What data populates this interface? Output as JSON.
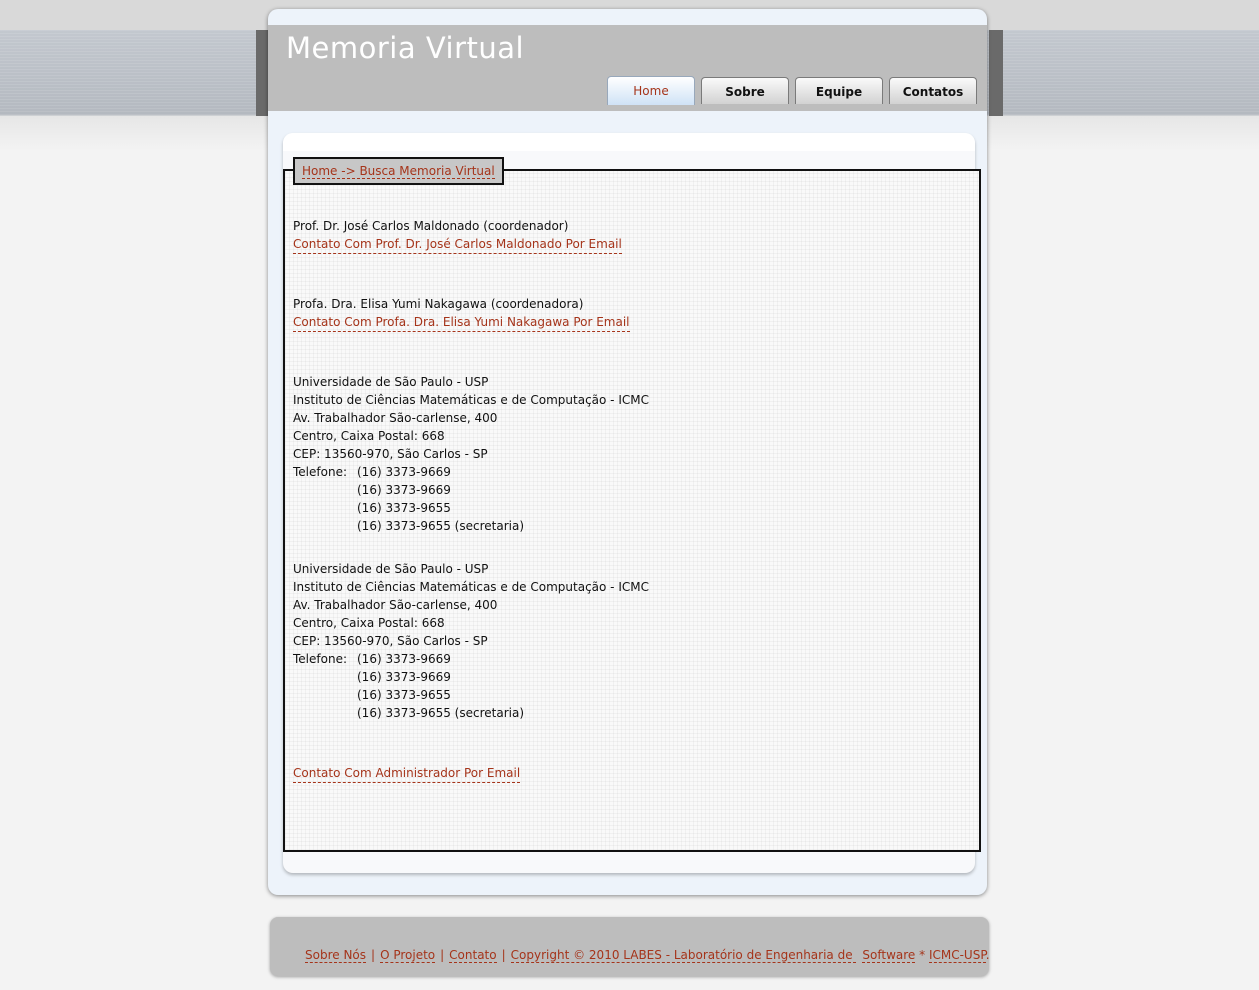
{
  "site": {
    "title": "Memoria Virtual"
  },
  "nav": {
    "tabs": [
      {
        "label": "Home",
        "active": true
      },
      {
        "label": "Sobre",
        "active": false
      },
      {
        "label": "Equipe",
        "active": false
      },
      {
        "label": "Contatos",
        "active": false
      }
    ]
  },
  "breadcrumb": "Home -> Busca Memoria Virtual",
  "contacts": [
    {
      "name": "Prof. Dr. José Carlos Maldonado (coordenador)",
      "link": "Contato Com Prof. Dr. José Carlos Maldonado Por Email"
    },
    {
      "name": "Profa. Dra. Elisa Yumi Nakagawa (coordenadora)",
      "link": "Contato Com Profa. Dra. Elisa Yumi Nakagawa Por Email"
    }
  ],
  "address": {
    "university": "Universidade de São Paulo - USP",
    "institute": "Instituto de Ciências Matemáticas e de Computação - ICMC",
    "street": "Av. Trabalhador São-carlense, 400",
    "postal": "Centro, Caixa Postal: 668",
    "cep": "CEP: 13560-970, São Carlos - SP",
    "phone_label": "Telefone:",
    "phones": [
      "(16) 3373-9669",
      "(16) 3373-9669",
      "(16) 3373-9655",
      "(16) 3373-9655 (secretaria)"
    ]
  },
  "admin_link": "Contato Com Administrador Por Email",
  "footer": {
    "about": "Sobre Nós",
    "project": "O Projeto",
    "contact": "Contato",
    "copyright_prefix": "Copyright © 2010 LABES - Laboratório de Engenharia de ",
    "software": "Software",
    "suffix_star": " * ",
    "icmc": "ICMC-USP",
    "period": "."
  },
  "colors": {
    "link": "#a5341a",
    "header": "#bdbdbd",
    "accent_tab": "#cfe2f6"
  }
}
